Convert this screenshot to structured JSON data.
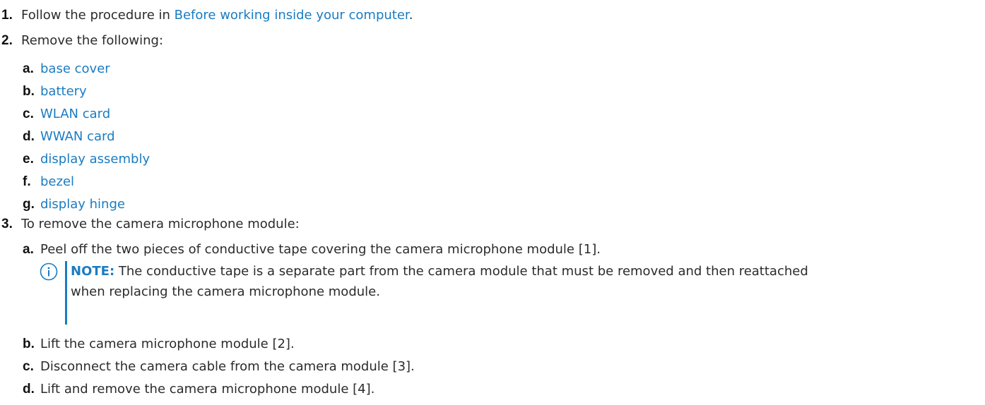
{
  "steps": [
    {
      "number": "1.",
      "text_before": "Follow the procedure in ",
      "link": "Before working inside your computer",
      "text_after": "."
    },
    {
      "number": "2.",
      "text": "Remove the following:",
      "items": [
        {
          "letter": "a.",
          "link": "base cover"
        },
        {
          "letter": "b.",
          "link": "battery"
        },
        {
          "letter": "c.",
          "link": "WLAN card"
        },
        {
          "letter": "d.",
          "link": "WWAN card"
        },
        {
          "letter": "e.",
          "link": "display assembly"
        },
        {
          "letter": "f.",
          "link": "bezel"
        },
        {
          "letter": "g.",
          "link": "display hinge"
        }
      ]
    },
    {
      "number": "3.",
      "text": "To remove the camera microphone module:",
      "items": [
        {
          "letter": "a.",
          "text": "Peel off the two pieces of conductive tape covering the camera microphone module [1]."
        },
        {
          "letter": "b.",
          "text": "Lift the camera microphone module [2]."
        },
        {
          "letter": "c.",
          "text": "Disconnect the camera cable from the camera module [3]."
        },
        {
          "letter": "d.",
          "text": "Lift and remove the camera microphone module [4]."
        }
      ],
      "note": {
        "label": "NOTE:",
        "line1": " The conductive tape is a separate part from the camera module that must be removed and then reattached",
        "line2": "when replacing the camera microphone module."
      }
    }
  ],
  "colors": {
    "link": "#1a7cc2",
    "text": "#2b2b2b",
    "marker": "#111111"
  },
  "icons": {
    "note": "info-circle-icon"
  }
}
